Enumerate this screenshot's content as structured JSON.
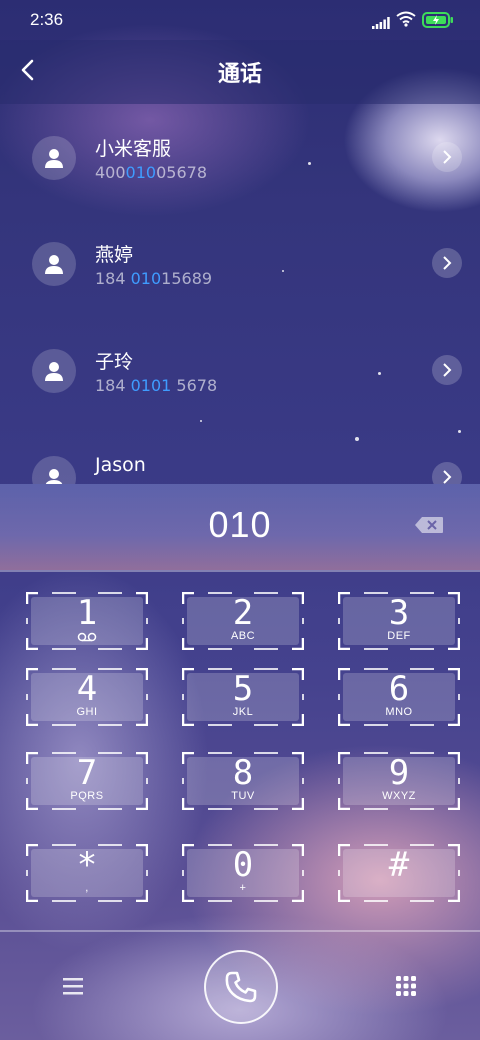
{
  "status_bar": {
    "time": "2:36"
  },
  "header": {
    "title": "通话"
  },
  "contacts": [
    {
      "name": "小米客服",
      "number_parts": [
        "400",
        "010",
        "05678"
      ]
    },
    {
      "name": "燕婷",
      "number_parts": [
        "184 ",
        "010",
        "15689"
      ]
    },
    {
      "name": "子玲",
      "number_parts": [
        "184 ",
        "0101",
        " 5678"
      ]
    },
    {
      "name": "Jason",
      "number_parts": [
        "",
        "",
        ""
      ]
    }
  ],
  "dialer": {
    "input": "010"
  },
  "keypad": [
    {
      "digit": "1",
      "letters": ""
    },
    {
      "digit": "2",
      "letters": "ABC"
    },
    {
      "digit": "3",
      "letters": "DEF"
    },
    {
      "digit": "4",
      "letters": "GHI"
    },
    {
      "digit": "5",
      "letters": "JKL"
    },
    {
      "digit": "6",
      "letters": "MNO"
    },
    {
      "digit": "7",
      "letters": "PQRS"
    },
    {
      "digit": "8",
      "letters": "TUV"
    },
    {
      "digit": "9",
      "letters": "WXYZ"
    },
    {
      "digit": "*",
      "letters": ","
    },
    {
      "digit": "0",
      "letters": "+"
    },
    {
      "digit": "#",
      "letters": ""
    }
  ],
  "colors": {
    "highlight": "#3f9cff",
    "battery": "#3ddc5a"
  },
  "icons": {
    "back": "chevron-left-icon",
    "contact": "person-icon",
    "row_action": "chevron-right-icon",
    "delete": "backspace-icon",
    "voicemail": "voicemail-icon",
    "menu": "menu-icon",
    "call": "phone-icon",
    "dialpad": "dialpad-icon"
  }
}
